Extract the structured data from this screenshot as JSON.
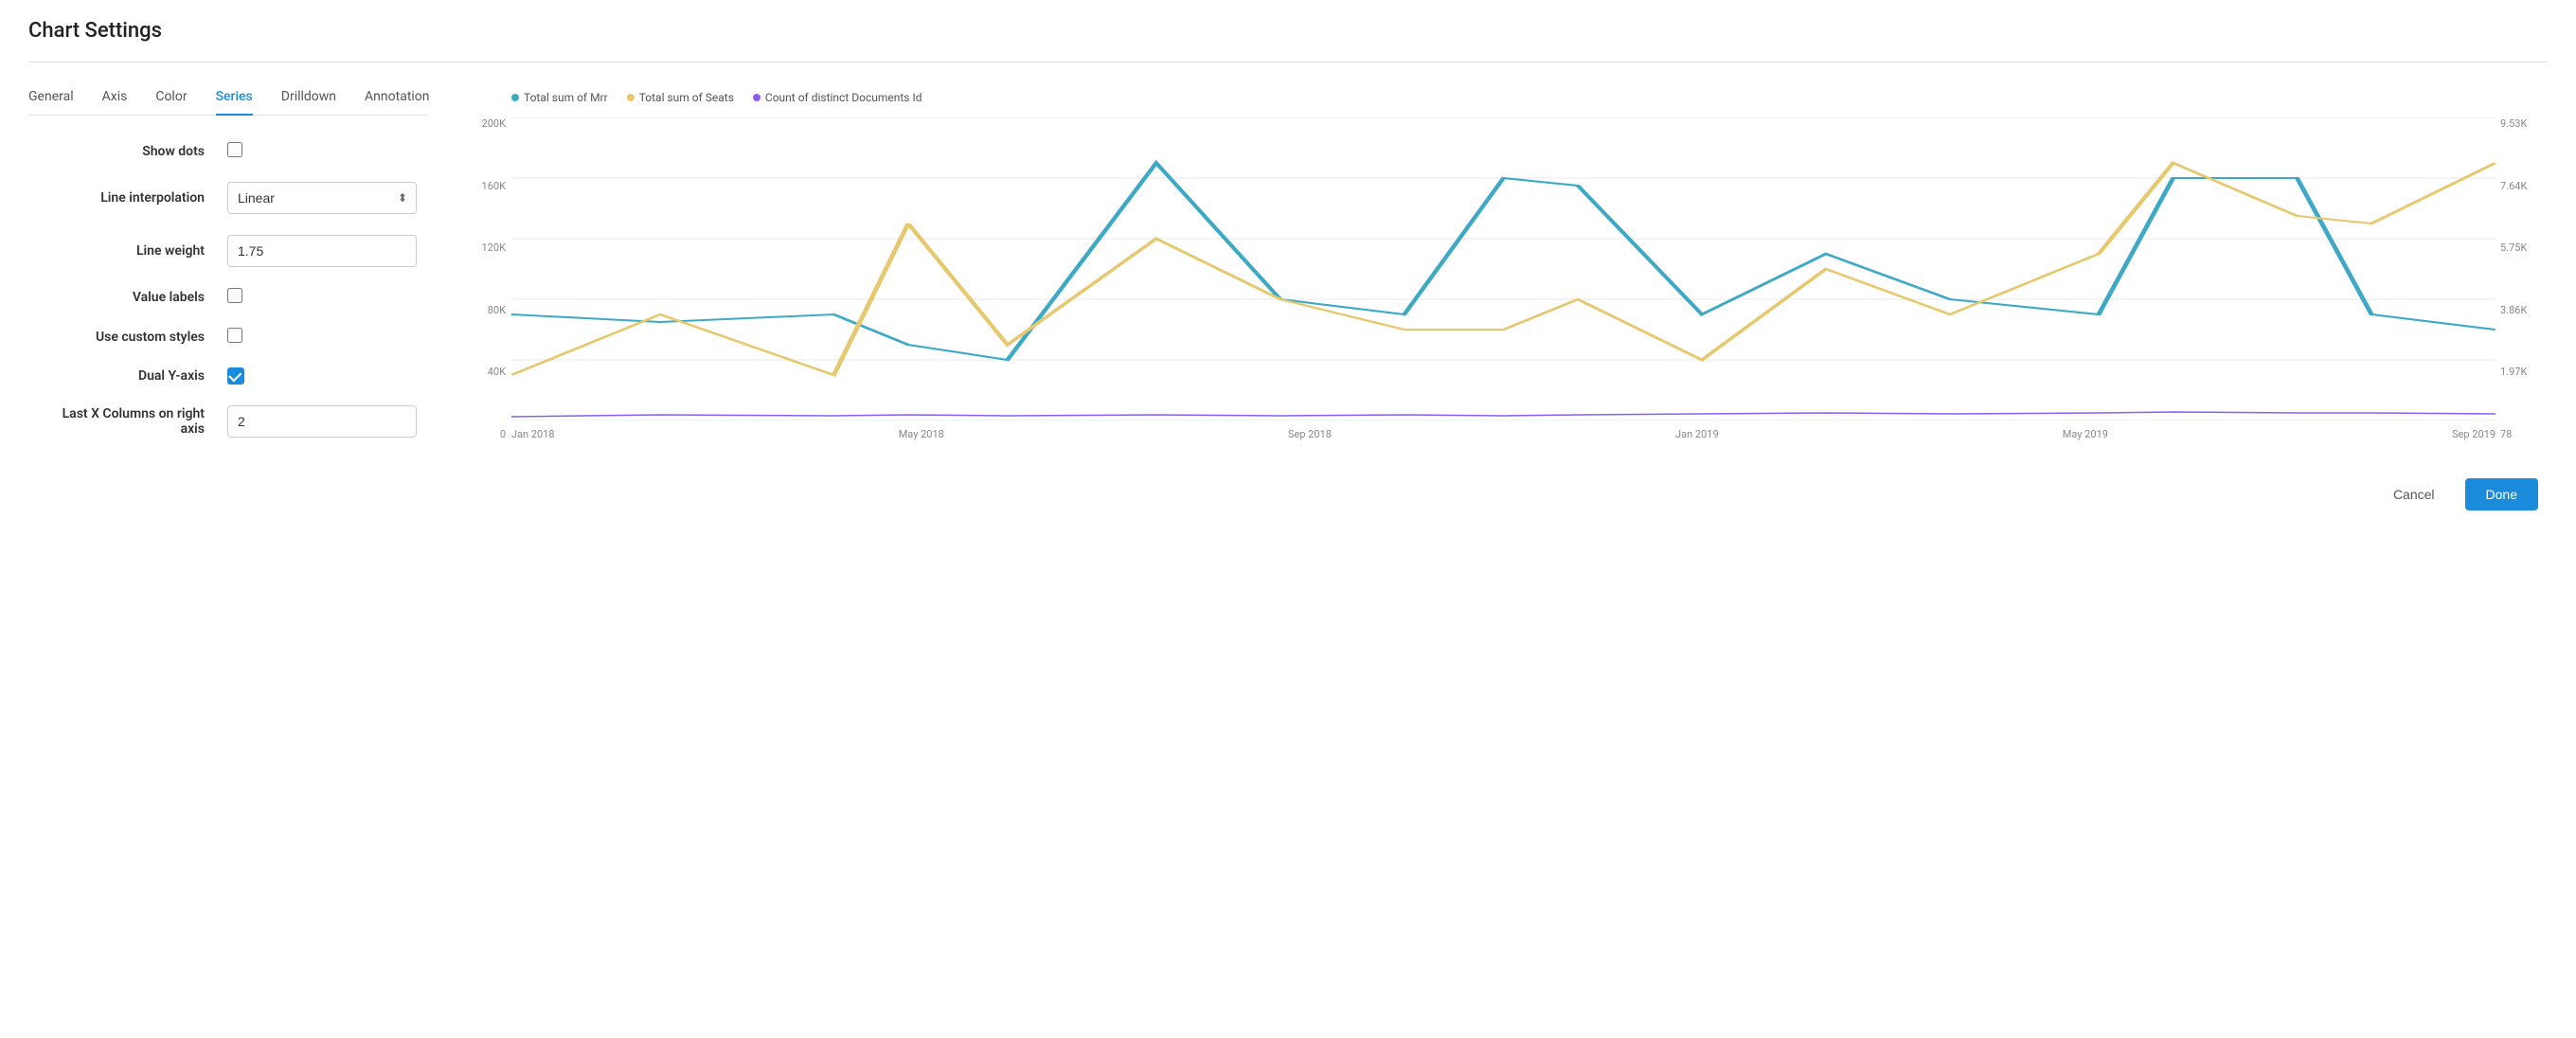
{
  "page": {
    "title": "Chart Settings"
  },
  "tabs": [
    {
      "id": "general",
      "label": "General",
      "active": false
    },
    {
      "id": "axis",
      "label": "Axis",
      "active": false
    },
    {
      "id": "color",
      "label": "Color",
      "active": false
    },
    {
      "id": "series",
      "label": "Series",
      "active": true
    },
    {
      "id": "drilldown",
      "label": "Drilldown",
      "active": false
    },
    {
      "id": "annotation",
      "label": "Annotation",
      "active": false
    }
  ],
  "form": {
    "show_dots_label": "Show dots",
    "line_interpolation_label": "Line interpolation",
    "line_interpolation_value": "Linear",
    "line_weight_label": "Line weight",
    "line_weight_value": "1.75",
    "value_labels_label": "Value labels",
    "use_custom_styles_label": "Use custom styles",
    "dual_y_axis_label": "Dual Y-axis",
    "last_x_columns_label": "Last X Columns on right axis",
    "last_x_columns_value": "2"
  },
  "chart": {
    "legend": [
      {
        "label": "Total sum of Mrr",
        "color": "#3da9c5"
      },
      {
        "label": "Total sum of Seats",
        "color": "#e6c86e"
      },
      {
        "label": "Count of distinct Documents Id",
        "color": "#8b5cf6"
      }
    ],
    "y_left_labels": [
      "200K",
      "160K",
      "120K",
      "80K",
      "40K",
      "0"
    ],
    "y_right_labels": [
      "9.53K",
      "7.64K",
      "5.75K",
      "3.86K",
      "1.97K",
      "78"
    ],
    "x_labels": [
      "Jan 2018",
      "May 2018",
      "Sep 2018",
      "Jan 2019",
      "May 2019",
      "Sep 2019"
    ]
  },
  "buttons": {
    "cancel_label": "Cancel",
    "done_label": "Done"
  }
}
